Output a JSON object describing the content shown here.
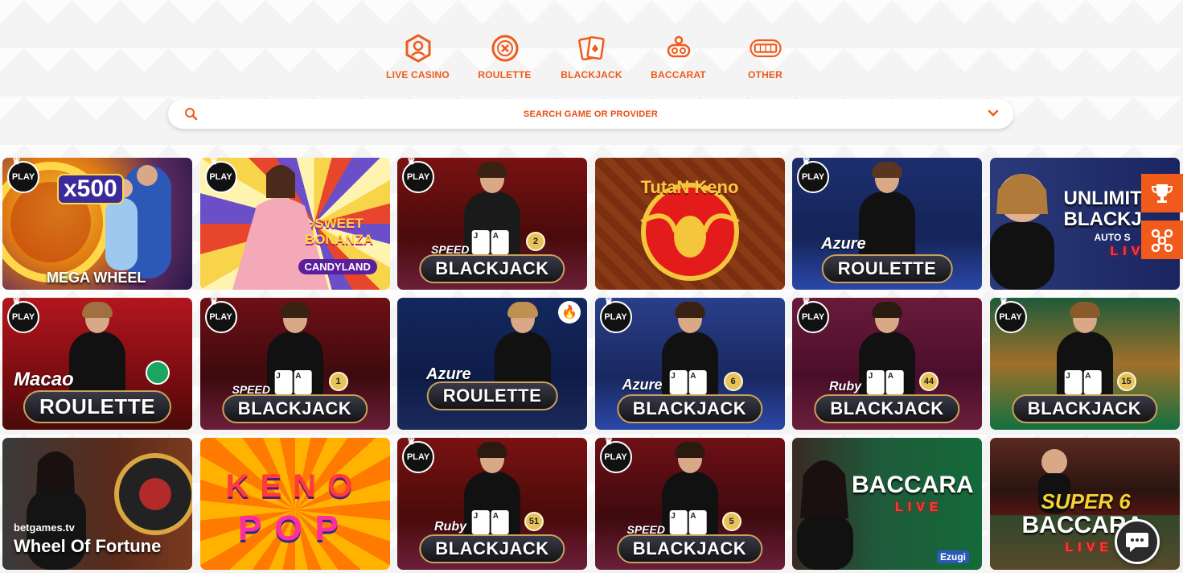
{
  "categories": [
    {
      "label": "LIVE CASINO",
      "icon": "live-dealer-icon"
    },
    {
      "label": "ROULETTE",
      "icon": "roulette-icon"
    },
    {
      "label": "BLACKJACK",
      "icon": "playing-cards-icon"
    },
    {
      "label": "BACCARAT",
      "icon": "baccarat-icon"
    },
    {
      "label": "OTHER",
      "icon": "slot-machine-icon"
    }
  ],
  "search": {
    "placeholder": "SEARCH GAME OR PROVIDER"
  },
  "play_badge": "PLAY",
  "games": [
    {
      "title": "MEGA WHEEL",
      "top_text": "x500"
    },
    {
      "title": "CANDYLAND",
      "top_text": "SWEET BONANZA"
    },
    {
      "title": "BLACKJACK",
      "prefix": "SPEED",
      "number": "2"
    },
    {
      "title": "TutaN Keno"
    },
    {
      "title": "ROULETTE",
      "prefix": "Azure"
    },
    {
      "title": "UNLIMITED BLACKJ",
      "sub": "AUTO S",
      "live": "LIVE"
    },
    {
      "title": "ROULETTE",
      "prefix": "Macao"
    },
    {
      "title": "BLACKJACK",
      "prefix": "SPEED",
      "number": "1"
    },
    {
      "title": "ROULETTE",
      "prefix": "Azure"
    },
    {
      "title": "BLACKJACK",
      "prefix": "Azure",
      "number": "6"
    },
    {
      "title": "BLACKJACK",
      "prefix": "Ruby",
      "number": "44"
    },
    {
      "title": "BLACKJACK",
      "number": "15"
    },
    {
      "title": "Wheel Of Fortune",
      "provider": "betgames.tv"
    },
    {
      "title_top": "KENO",
      "title_bottom": "POP"
    },
    {
      "title": "BLACKJACK",
      "prefix": "Ruby",
      "number": "51"
    },
    {
      "title": "BLACKJACK",
      "prefix": "SPEED",
      "number": "5"
    },
    {
      "title": "BACCARA",
      "live": "LIVE",
      "provider": "Ezugi"
    },
    {
      "title": "SUPER 6",
      "title2": "BACCARA",
      "live": "LIVE"
    }
  ],
  "colors": {
    "accent": "#f05a1a"
  }
}
